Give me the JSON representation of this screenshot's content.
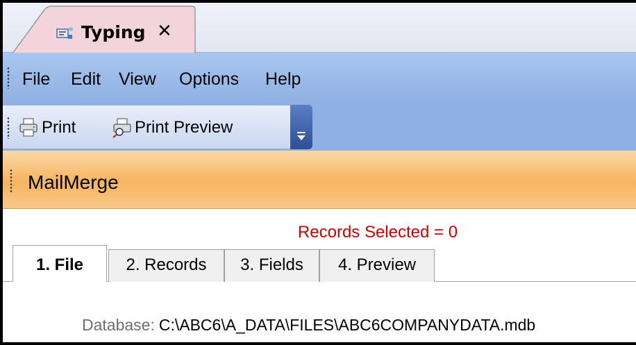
{
  "window_tab": {
    "title": "Typing",
    "close_label": "✕",
    "icon": "typing-app-icon"
  },
  "menu": {
    "items": [
      "File",
      "Edit",
      "View",
      "Options",
      "Help"
    ]
  },
  "toolbar": {
    "print_label": "Print",
    "print_preview_label": "Print Preview",
    "print_icon": "printer-icon",
    "print_preview_icon": "print-preview-icon"
  },
  "panel": {
    "title": "MailMerge"
  },
  "status": {
    "records_selected": "Records Selected = 0"
  },
  "tabs": [
    {
      "label": "1. File",
      "active": true
    },
    {
      "label": "2. Records",
      "active": false
    },
    {
      "label": "3. Fields",
      "active": false
    },
    {
      "label": "4. Preview",
      "active": false
    }
  ],
  "database": {
    "label": "Database:",
    "value": "C:\\ABC6\\A_DATA\\FILES\\ABC6COMPANYDATA.mdb"
  },
  "colors": {
    "menubar": "#8fb0e3",
    "panel_header": "#f6b45f",
    "status_text": "#cc0000",
    "tab_active": "#f4d4dc"
  }
}
